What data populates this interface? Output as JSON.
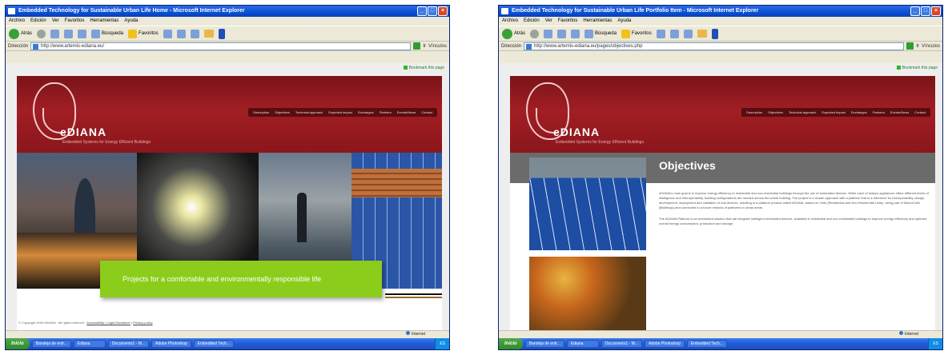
{
  "left_window": {
    "title": "Embedded Technology for Sustainable Urban Life Home - Microsoft Internet Explorer",
    "menu": [
      "Archivo",
      "Edición",
      "Ver",
      "Favoritos",
      "Herramientas",
      "Ayuda"
    ],
    "toolbar": {
      "back_label": "Atrás",
      "search_label": "Búsqueda",
      "favorites_label": "Favoritos"
    },
    "address_label": "Dirección",
    "address": "http://www.artemis-ediana.eu/",
    "go_label": "Ir",
    "links_label": "Vínculos",
    "bookmark_link": "Bookmark this page",
    "site": {
      "brand": "eDIANA",
      "tagline": "Embedded Systems for Energy Efficient Buildings",
      "nav": [
        "Description",
        "Objectives",
        "Technical approach",
        "Expected impact",
        "Exchanges",
        "Partners",
        "Events/News",
        "Contact"
      ],
      "slogan": "Projects for a comfortable and environmentally responsible life",
      "footer_copyright": "© Copyright 2009 eDIANA · All rights reserved ·",
      "footer_links": [
        "Accessibility / Legal Disclaimer",
        "Privacy policy"
      ]
    },
    "status": "Internet",
    "taskbar": {
      "start": "Inicio",
      "tasks": [
        "Bandeja de entr...",
        "Ediana",
        "Documento1 - M...",
        "Adobe Photoshop",
        "Embedded Tech..."
      ],
      "tray": "ES"
    }
  },
  "right_window": {
    "title": "Embedded Technology for Sustainable Urban Life Portfolio Item - Microsoft Internet Explorer",
    "menu": [
      "Archivo",
      "Edición",
      "Ver",
      "Favoritos",
      "Herramientas",
      "Ayuda"
    ],
    "toolbar": {
      "back_label": "Atrás",
      "search_label": "Búsqueda",
      "favorites_label": "Favoritos"
    },
    "address_label": "Dirección",
    "address": "http://www.artemis-ediana.eu/pages/objectives.php",
    "go_label": "Ir",
    "links_label": "Vínculos",
    "bookmark_link": "Bookmark this page",
    "site": {
      "brand": "eDIANA",
      "tagline": "Embedded Systems for Energy Efficient Buildings",
      "nav": [
        "Description",
        "Objectives",
        "Technical approach",
        "Expected impact",
        "Exchanges",
        "Partners",
        "Events/News",
        "Contact"
      ],
      "page_title": "Objectives",
      "paragraphs": [
        "eDIANA's main goal is to improve energy efficiency in residential and non-residential buildings through the use of embedded devices. While each of today's appliances offers different levels of intelligence and interoperability, building configurations are needed across the whole building. The project is a cluster approach with a platform that is a reference for interoperability, design, development, deployment and validation of real devices, resulting in a platform product called eDIANA, based on Cells (Residential and Non-Residential Units), being part of MacroCells (Buildings) and connected to a future network of platforms in urban areas.",
        "The eDIANA Platform is an embedded solution that will integrate intelligent embedded devices, available in residential and non-residential buildings to improve energy efficiency and optimize overall energy consumption, production and storage."
      ]
    },
    "status": "Internet",
    "taskbar": {
      "start": "Inicio",
      "tasks": [
        "Bandeja de entr...",
        "Ediana",
        "Documento1 - M...",
        "Adobe Photoshop",
        "Embedded Tech..."
      ],
      "tray": "ES"
    }
  }
}
